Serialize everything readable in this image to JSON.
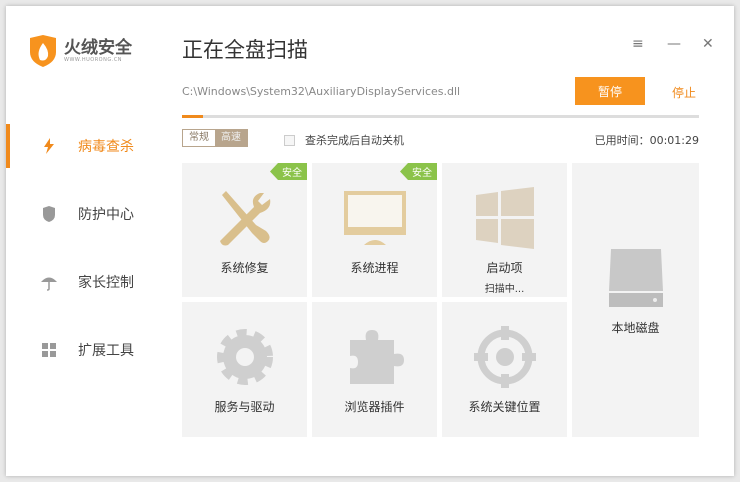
{
  "app": {
    "name": "火绒安全",
    "url": "WWW.HUORONG.CN"
  },
  "sidebar": {
    "items": [
      {
        "label": "病毒查杀",
        "icon": "lightning-icon",
        "active": true
      },
      {
        "label": "防护中心",
        "icon": "shield-icon"
      },
      {
        "label": "家长控制",
        "icon": "umbrella-icon"
      },
      {
        "label": "扩展工具",
        "icon": "grid-icon"
      }
    ]
  },
  "header": {
    "title": "正在全盘扫描",
    "menu_icon": "≡",
    "min_icon": "—",
    "close_icon": "✕"
  },
  "scan": {
    "path": "C:\\Windows\\System32\\AuxiliaryDisplayServices.dll",
    "pause": "暂停",
    "stop": "停止",
    "progress_percent": 4,
    "mode_normal": "常规",
    "mode_fast": "高速",
    "auto_shutdown": "查杀完成后自动关机",
    "elapsed": "已用时间：00:01:29"
  },
  "tiles": [
    {
      "label": "系统修复",
      "badge": "安全",
      "icon": "tools-icon"
    },
    {
      "label": "系统进程",
      "badge": "安全",
      "icon": "monitor-icon"
    },
    {
      "label": "启动项",
      "status": "扫描中...",
      "icon": "windows-icon"
    },
    {
      "label": "本地磁盘",
      "icon": "disk-icon"
    },
    {
      "label": "服务与驱动",
      "icon": "gear-icon"
    },
    {
      "label": "浏览器插件",
      "icon": "puzzle-icon"
    },
    {
      "label": "系统关键位置",
      "icon": "target-icon"
    }
  ],
  "colors": {
    "accent": "#f7931e",
    "safe": "#8bc34a",
    "icon": "#dcc8a0"
  }
}
